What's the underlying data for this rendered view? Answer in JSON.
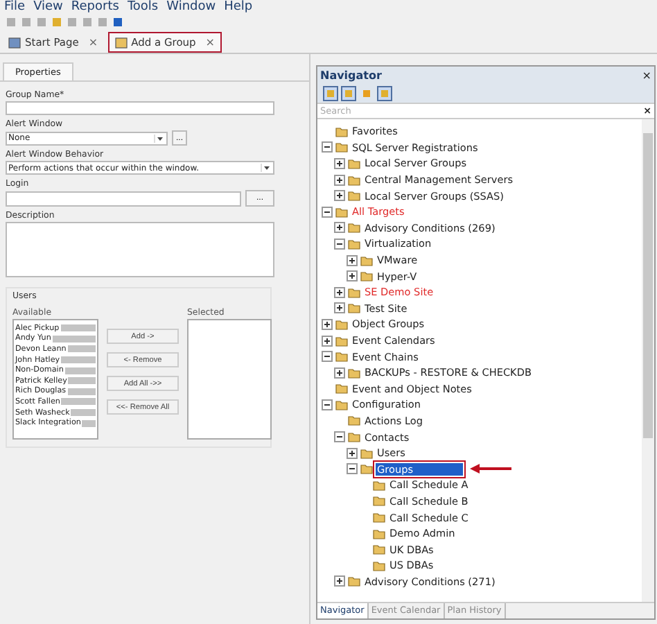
{
  "menu": [
    "File",
    "View",
    "Reports",
    "Tools",
    "Window",
    "Help"
  ],
  "doc_tabs": [
    {
      "label": "Start Page",
      "selected": false,
      "close": "×"
    },
    {
      "label": "Add a Group",
      "selected": true,
      "close": "×"
    }
  ],
  "properties_tab": "Properties",
  "form": {
    "group_name_label": "Group Name*",
    "alert_window_label": "Alert Window",
    "alert_window_value": "None",
    "browse": "...",
    "behavior_label": "Alert Window Behavior",
    "behavior_value": "Perform actions that occur within the window.",
    "login_label": "Login",
    "login_browse": "...",
    "description_label": "Description"
  },
  "users": {
    "title": "Users",
    "available_label": "Available",
    "selected_label": "Selected",
    "available": [
      "Alec Pickup",
      "Andy Yun",
      "Devon Leann",
      "John Hatley",
      "Non-Domain",
      "Patrick Kelley",
      "Rich Douglas",
      "Scott Fallen",
      "Seth Washeck",
      "Slack Integration"
    ],
    "buttons": [
      "Add ->",
      "<- Remove",
      "Add All ->>",
      "<<- Remove All"
    ]
  },
  "navigator": {
    "title": "Navigator",
    "close": "×",
    "search_placeholder": "Search",
    "search_clear": "×",
    "tree": [
      {
        "label": "Favorites",
        "highlighted": false,
        "selected": false
      },
      {
        "label": "SQL Server Registrations",
        "highlighted": false,
        "selected": false,
        "expanded": true,
        "children": [
          {
            "label": "Local Server Groups",
            "highlighted": false,
            "selected": false,
            "expanded": false
          },
          {
            "label": "Central Management Servers",
            "highlighted": false,
            "selected": false,
            "expanded": false
          },
          {
            "label": "Local Server Groups (SSAS)",
            "highlighted": false,
            "selected": false,
            "expanded": false
          }
        ]
      },
      {
        "label": "All Targets",
        "highlighted": true,
        "selected": false,
        "expanded": true,
        "children": [
          {
            "label": "Advisory Conditions (269)",
            "highlighted": false,
            "selected": false,
            "expanded": false
          },
          {
            "label": "Virtualization",
            "highlighted": false,
            "selected": false,
            "expanded": true,
            "children": [
              {
                "label": "VMware",
                "highlighted": false,
                "selected": false,
                "expanded": false
              },
              {
                "label": "Hyper-V",
                "highlighted": false,
                "selected": false,
                "expanded": false
              }
            ]
          },
          {
            "label": "SE Demo Site",
            "highlighted": true,
            "selected": false,
            "expanded": false
          },
          {
            "label": "Test Site",
            "highlighted": false,
            "selected": false,
            "expanded": false
          }
        ]
      },
      {
        "label": "Object Groups",
        "highlighted": false,
        "selected": false,
        "expanded": false
      },
      {
        "label": "Event Calendars",
        "highlighted": false,
        "selected": false,
        "expanded": false
      },
      {
        "label": "Event Chains",
        "highlighted": false,
        "selected": false,
        "expanded": true,
        "children": [
          {
            "label": "BACKUPs - RESTORE & CHECKDB",
            "highlighted": false,
            "selected": false,
            "expanded": false
          }
        ]
      },
      {
        "label": "Event and Object Notes",
        "highlighted": false,
        "selected": false
      },
      {
        "label": "Configuration",
        "highlighted": false,
        "selected": false,
        "expanded": true,
        "children": [
          {
            "label": "Actions Log",
            "highlighted": false,
            "selected": false
          },
          {
            "label": "Contacts",
            "highlighted": false,
            "selected": false,
            "expanded": true,
            "children": [
              {
                "label": "Users",
                "highlighted": false,
                "selected": false,
                "expanded": false
              },
              {
                "label": "Groups",
                "highlighted": false,
                "selected": true,
                "expanded": true,
                "children": [
                  {
                    "label": "Call Schedule A",
                    "highlighted": false,
                    "selected": false
                  },
                  {
                    "label": "Call Schedule B",
                    "highlighted": false,
                    "selected": false
                  },
                  {
                    "label": "Call Schedule C",
                    "highlighted": false,
                    "selected": false
                  },
                  {
                    "label": "Demo Admin",
                    "highlighted": false,
                    "selected": false
                  },
                  {
                    "label": "UK DBAs",
                    "highlighted": false,
                    "selected": false
                  },
                  {
                    "label": "US DBAs",
                    "highlighted": false,
                    "selected": false
                  }
                ]
              }
            ]
          },
          {
            "label": "Advisory Conditions (271)",
            "highlighted": false,
            "selected": false,
            "expanded": false
          }
        ]
      }
    ],
    "bottom_tabs": [
      {
        "label": "Navigator",
        "selected": true
      },
      {
        "label": "Event Calendar",
        "selected": false
      },
      {
        "label": "Plan History",
        "selected": false
      }
    ]
  }
}
